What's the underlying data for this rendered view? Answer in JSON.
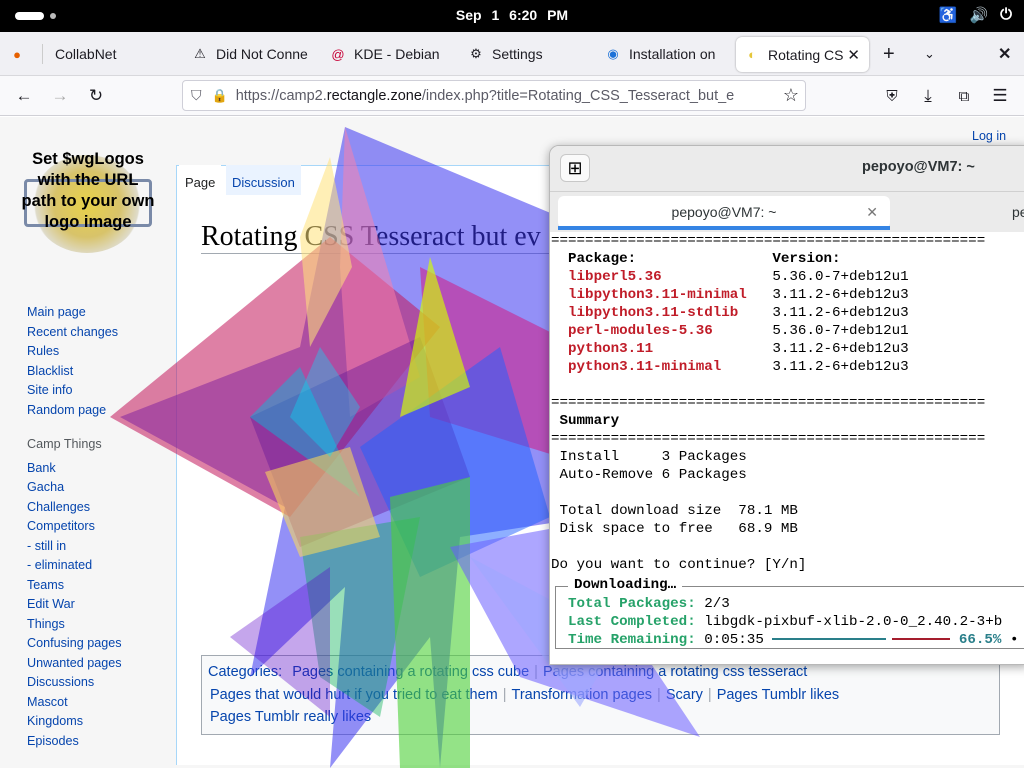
{
  "topbar": {
    "date": "Sep 1",
    "time": "6:20 PM",
    "tray_icons": [
      "accessibility-icon",
      "volume-icon",
      "power-icon"
    ]
  },
  "browser": {
    "tabs": [
      {
        "label": "CollabNet",
        "icon": "firefox-icon"
      },
      {
        "label": "Did Not Conne",
        "icon": "warning-icon"
      },
      {
        "label": "KDE - Debian",
        "icon": "debian-icon"
      },
      {
        "label": "Settings",
        "icon": "gear-icon"
      },
      {
        "label": "Installation on",
        "icon": "site-icon"
      },
      {
        "label": "Rotating CS",
        "icon": "site-icon",
        "active": true
      }
    ],
    "url_prefix": "https://camp2.",
    "url_host": "rectangle.zone",
    "url_path": "/index.php?title=Rotating_CSS_Tesseract_but_e"
  },
  "wiki": {
    "logo_text": "Set $wgLogos with the URL path to your own logo image",
    "login": "Log in",
    "tab_page": "Page",
    "tab_discussion": "Discussion",
    "title": "Rotating CSS Tesseract but ev",
    "nav": [
      "Main page",
      "Recent changes",
      "Rules",
      "Blacklist",
      "Site info",
      "Random page"
    ],
    "camp_heading": "Camp Things",
    "camp": [
      "Bank",
      "Gacha",
      "Challenges",
      "Competitors",
      "- still in",
      "- eliminated",
      "Teams",
      "Edit War",
      "Things",
      "Confusing pages",
      "Unwanted pages",
      "Discussions",
      "Mascot",
      "Kingdoms",
      "Episodes"
    ],
    "categories_label": "Categories:",
    "categories": [
      "Pages containing a rotating css cube",
      "Pages containing a rotating css tesseract",
      "Pages that would hurt if you tried to eat them",
      "Transformation pages",
      "Scary",
      "Pages Tumblr likes",
      "Pages Tumblr really likes"
    ]
  },
  "terminal": {
    "window_title": "pepoyo@VM7: ~",
    "tab1": "pepoyo@VM7: ~",
    "tab2": "pe",
    "rule": "===================================================",
    "pkg_header": "Package:",
    "ver_header": "Version:",
    "packages": [
      {
        "name": "libperl5.36",
        "version": "5.36.0-7+deb12u1"
      },
      {
        "name": "libpython3.11-minimal",
        "version": "3.11.2-6+deb12u3"
      },
      {
        "name": "libpython3.11-stdlib",
        "version": "3.11.2-6+deb12u3"
      },
      {
        "name": "perl-modules-5.36",
        "version": "5.36.0-7+deb12u1"
      },
      {
        "name": "python3.11",
        "version": "3.11.2-6+deb12u3"
      },
      {
        "name": "python3.11-minimal",
        "version": "3.11.2-6+deb12u3"
      }
    ],
    "summary": "Summary",
    "install": "Install     3 Packages",
    "autoremove": "Auto-Remove 6 Packages",
    "download": "Total download size  78.1 MB",
    "disk": "Disk space to free   68.9 MB",
    "prompt": "Do you want to continue? [Y/n]",
    "dl_legend": "Downloading…",
    "total_label": "Total Packages:",
    "total_value": "2/3",
    "last_label": "Last Completed:",
    "last_value": "libgdk-pixbuf-xlib-2.0-0_2.40.2-3+b",
    "time_label": "Time Remaining:",
    "time_value": "0:05:35",
    "percent": "66.5%",
    "progress": 0.665
  }
}
